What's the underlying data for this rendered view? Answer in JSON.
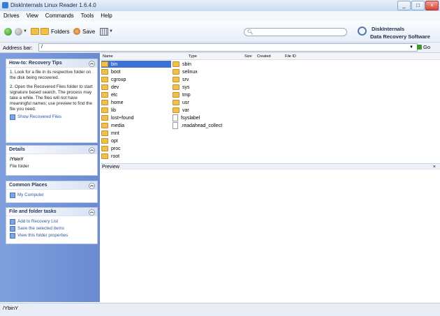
{
  "window": {
    "title": "DiskInternals Linux Reader 1.6.4.0",
    "buttons": [
      "_",
      "□",
      "×"
    ]
  },
  "menu": [
    "Drives",
    "View",
    "Commands",
    "Tools",
    "Help"
  ],
  "toolbar": {
    "folders_label": "Folders",
    "save_label": "Save",
    "search_value": ""
  },
  "brand": {
    "line1": "DiskInternals",
    "line2": "Data Recovery Software"
  },
  "address": {
    "label": "Address bar:",
    "value": "/",
    "go_label": "Go"
  },
  "panels": {
    "tips": {
      "title": "How-to: Recovery Tips",
      "p1": "1. Look for a file in its respective folder on the disk being recovered.",
      "p2": "2. Open the Recovered Files folder to start signature based search. The process may take a while. The files will not have meaningful names; use preview to find the file you need.",
      "link": "Show Recovered Files"
    },
    "details": {
      "title": "Details",
      "name": "/YbinY",
      "type": "File folder"
    },
    "places": {
      "title": "Common Places",
      "link": "My Computer"
    },
    "tasks": {
      "title": "File and folder tasks",
      "links": [
        "Add to Recovery List",
        "Save the selected items",
        "View this folder properties"
      ]
    }
  },
  "columns": [
    "Name",
    "Type",
    "Size",
    "Created",
    "File ID"
  ],
  "files_col1": [
    "bin",
    "boot",
    "cgroup",
    "dev",
    "etc",
    "home",
    "lib",
    "lost+found",
    "media",
    "mnt",
    "opt",
    "proc",
    "root"
  ],
  "files_col2": [
    {
      "name": "sbin",
      "kind": "folder"
    },
    {
      "name": "selinux",
      "kind": "folder"
    },
    {
      "name": "srv",
      "kind": "folder"
    },
    {
      "name": "sys",
      "kind": "folder"
    },
    {
      "name": "tmp",
      "kind": "folder"
    },
    {
      "name": "usr",
      "kind": "folder"
    },
    {
      "name": "var",
      "kind": "folder"
    },
    {
      "name": "fsyslabel",
      "kind": "file"
    },
    {
      "name": ".readahead_collect",
      "kind": "file"
    }
  ],
  "preview_label": "Preview",
  "status": "/YbinY",
  "colors": {
    "sidebar": "#7f9fdd",
    "selection": "#3b72d6",
    "folder": "#f1c04a"
  }
}
